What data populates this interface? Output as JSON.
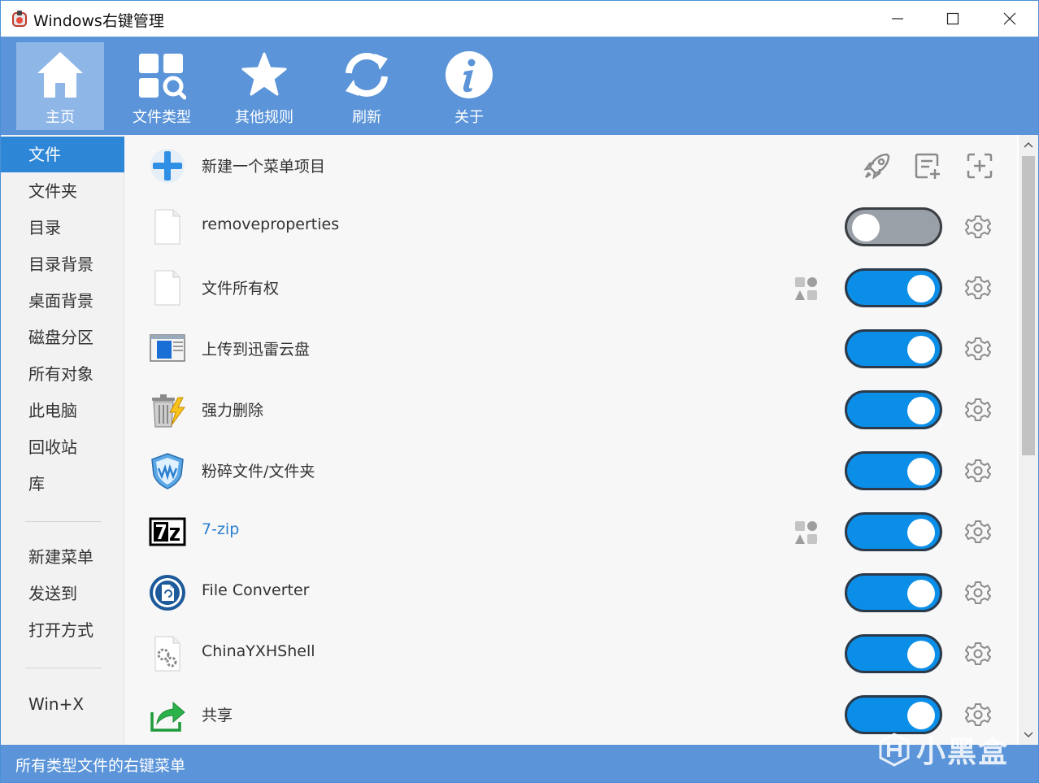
{
  "window": {
    "title": "Windows右键管理",
    "accent": "#5b94d8",
    "selection": "#2d86d6",
    "toggle_on": "#0a8ee8",
    "toggle_off": "#9aa0a7"
  },
  "toolbar": {
    "items": [
      {
        "label": "主页",
        "icon": "home-icon",
        "active": true
      },
      {
        "label": "文件类型",
        "icon": "file-types-icon",
        "active": false
      },
      {
        "label": "其他规则",
        "icon": "star-icon",
        "active": false
      },
      {
        "label": "刷新",
        "icon": "refresh-icon",
        "active": false
      },
      {
        "label": "关于",
        "icon": "info-icon",
        "active": false
      }
    ]
  },
  "sidebar": {
    "items": [
      {
        "label": "文件",
        "active": true
      },
      {
        "label": "文件夹"
      },
      {
        "label": "目录"
      },
      {
        "label": "目录背景"
      },
      {
        "label": "桌面背景"
      },
      {
        "label": "磁盘分区"
      },
      {
        "label": "所有对象"
      },
      {
        "label": "此电脑"
      },
      {
        "label": "回收站"
      },
      {
        "label": "库"
      },
      {
        "label": "新建菜单"
      },
      {
        "label": "发送到"
      },
      {
        "label": "打开方式"
      },
      {
        "label": "Win+X"
      }
    ]
  },
  "list": {
    "new_item_label": "新建一个菜单项目",
    "new_item_actions": [
      "rocket-icon",
      "add-note-icon",
      "add-target-icon"
    ],
    "rows": [
      {
        "name": "removeproperties",
        "icon": "blank-file-icon",
        "enabled": false,
        "multi": false
      },
      {
        "name": "文件所有权",
        "icon": "blank-file-icon",
        "enabled": true,
        "multi": true
      },
      {
        "name": "上传到迅雷云盘",
        "icon": "window-icon",
        "enabled": true,
        "multi": false
      },
      {
        "name": "强力删除",
        "icon": "trash-bolt-icon",
        "enabled": true,
        "multi": false
      },
      {
        "name": "粉碎文件/文件夹",
        "icon": "shield-icon",
        "enabled": true,
        "multi": false
      },
      {
        "name": "7-zip",
        "icon": "7zip-icon",
        "enabled": true,
        "multi": true,
        "link": true
      },
      {
        "name": "File Converter",
        "icon": "file-converter-icon",
        "enabled": true,
        "multi": false
      },
      {
        "name": "ChinaYXHShell",
        "icon": "gears-file-icon",
        "enabled": true,
        "multi": false
      },
      {
        "name": "共享",
        "icon": "share-icon",
        "enabled": true,
        "multi": false
      }
    ]
  },
  "status": {
    "text": "所有类型文件的右键菜单",
    "watermark": "小黑盒"
  }
}
